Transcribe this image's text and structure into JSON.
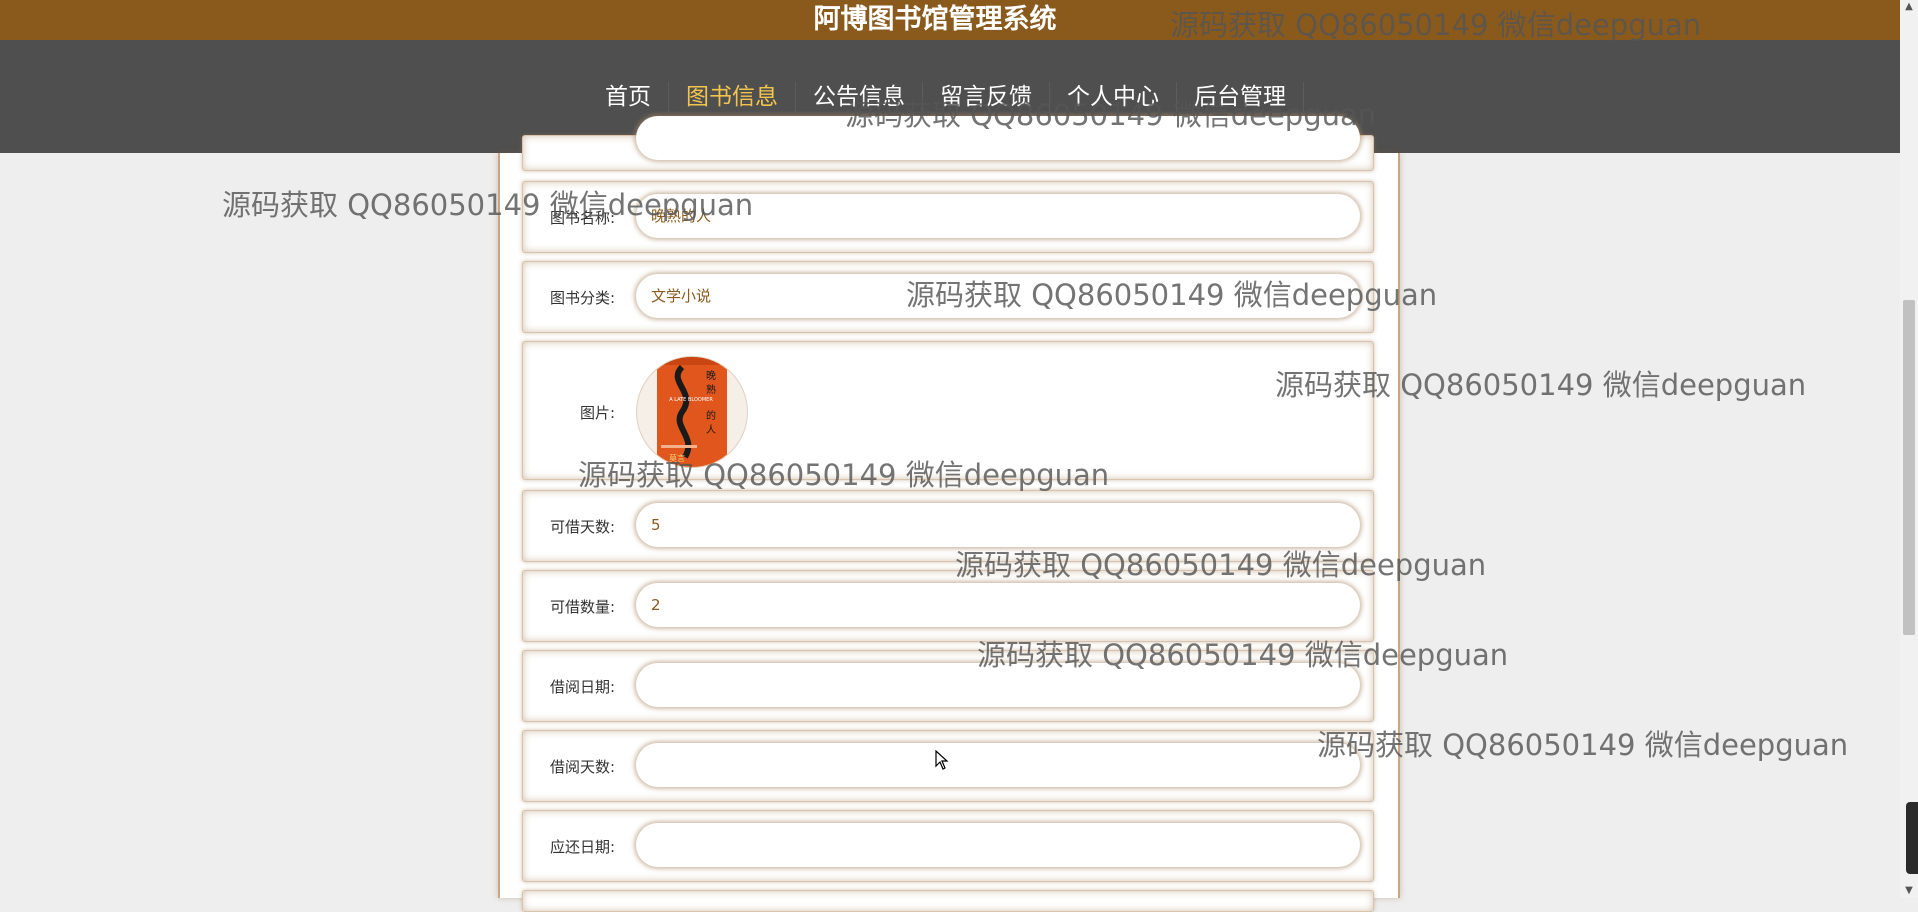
{
  "header": {
    "title": "阿博图书馆管理系统"
  },
  "nav": {
    "items": [
      {
        "label": "首页",
        "active": false
      },
      {
        "label": "图书信息",
        "active": true
      },
      {
        "label": "公告信息",
        "active": false
      },
      {
        "label": "留言反馈",
        "active": false
      },
      {
        "label": "个人中心",
        "active": false
      },
      {
        "label": "后台管理",
        "active": false
      }
    ]
  },
  "form": {
    "book_name": {
      "label": "图书名称:",
      "value": "晚熟的人"
    },
    "category": {
      "label": "图书分类:",
      "value": "文学小说"
    },
    "image": {
      "label": "图片:",
      "cover_title": "晚熟的人",
      "cover_subtitle": "A LATE BLOOMER",
      "cover_author": "莫言"
    },
    "loan_days_allowed": {
      "label": "可借天数:",
      "value": "5"
    },
    "loan_quantity": {
      "label": "可借数量:",
      "value": "2"
    },
    "borrow_date": {
      "label": "借阅日期:",
      "value": ""
    },
    "borrow_days": {
      "label": "借阅天数:",
      "value": ""
    },
    "return_date": {
      "label": "应还日期:",
      "value": ""
    }
  },
  "watermark": {
    "text": "源码获取 QQ86050149 微信deepguan"
  },
  "colors": {
    "topbar": "#8a5a1d",
    "navbar": "#4f4f4f",
    "nav_active": "#f1c54d",
    "input_text": "#8a5a1d",
    "cover_orange": "#e0561c"
  },
  "icons": {
    "cursor": "mouse-pointer-icon",
    "scroll_up": "triangle-up",
    "scroll_down": "triangle-down"
  }
}
